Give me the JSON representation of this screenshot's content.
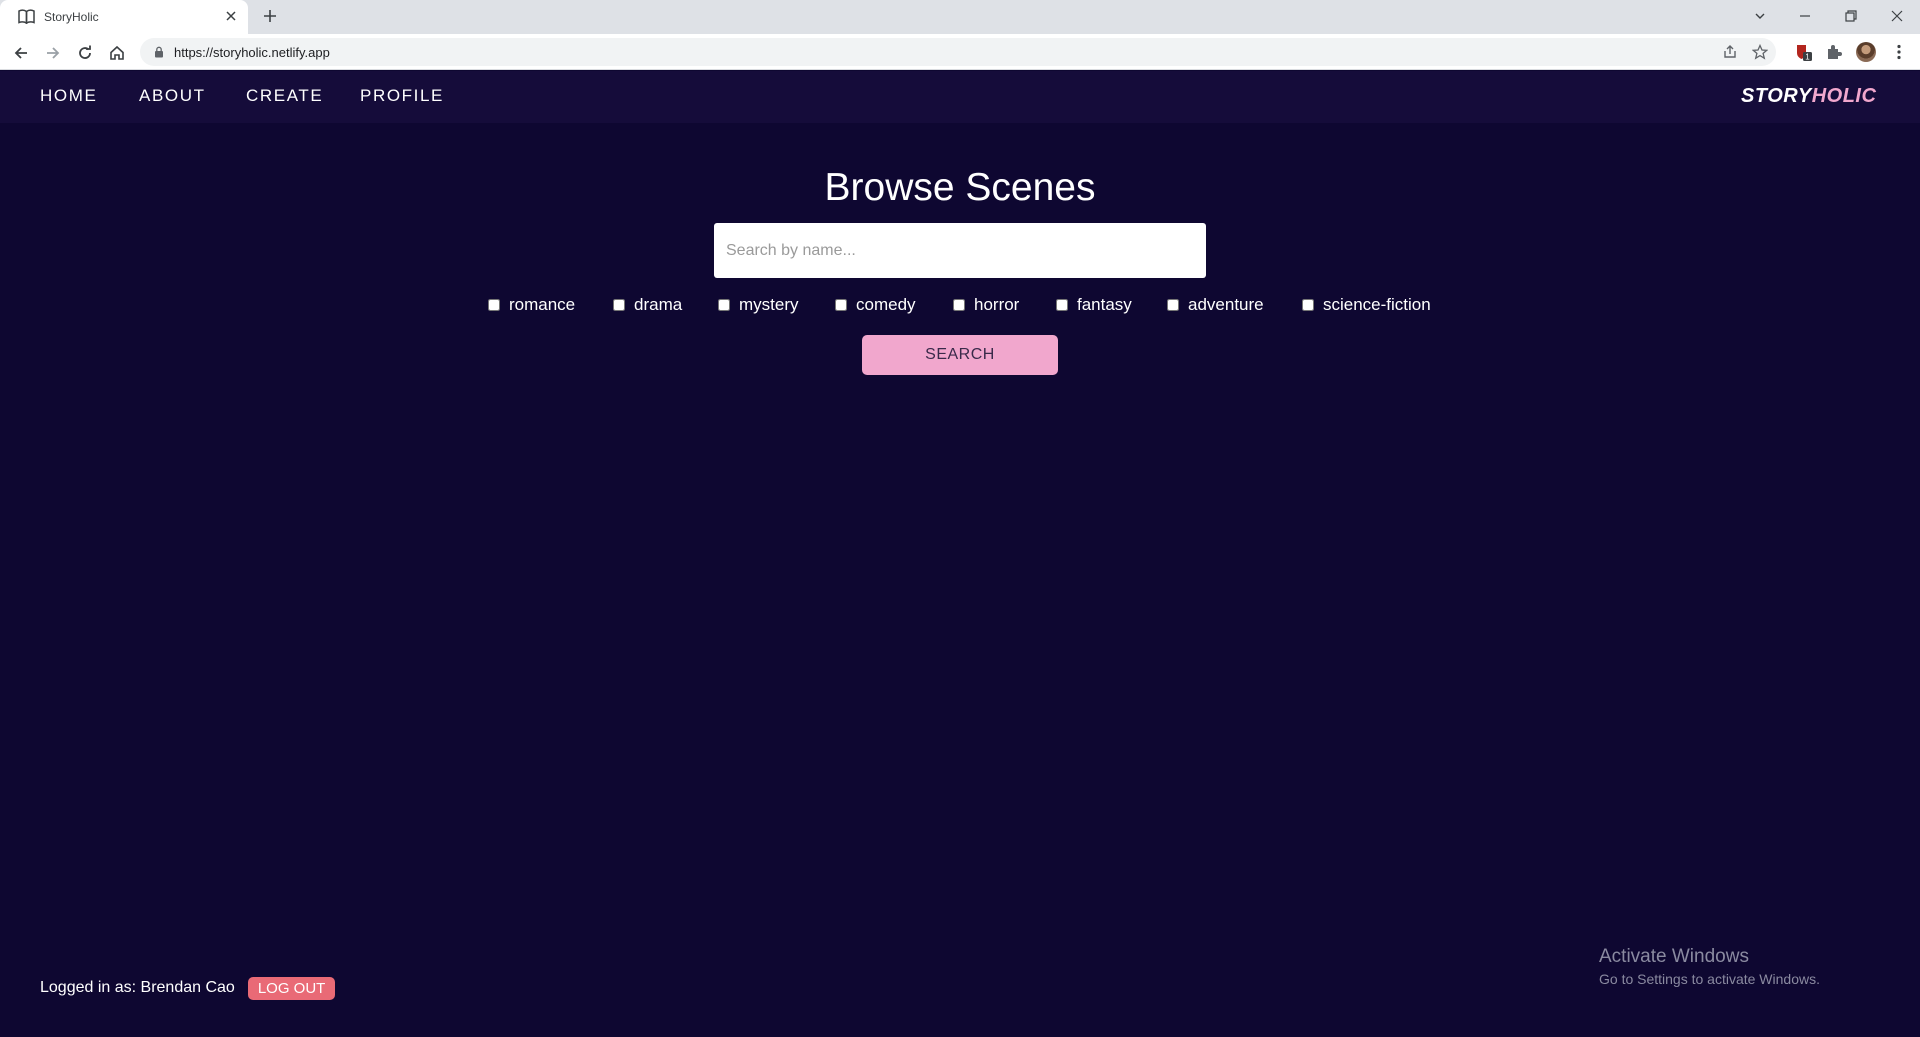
{
  "browser": {
    "tab_title": "StoryHolic",
    "url": "https://storyholic.netlify.app",
    "extension_badge": "1"
  },
  "nav": {
    "links": [
      "HOME",
      "ABOUT",
      "CREATE",
      "PROFILE"
    ],
    "brand_part1": "STORY",
    "brand_part2": "HOLIC"
  },
  "main": {
    "title": "Browse Scenes",
    "search_placeholder": "Search by name...",
    "genres": [
      "romance",
      "drama",
      "mystery",
      "comedy",
      "horror",
      "fantasy",
      "adventure",
      "science-fiction"
    ],
    "search_button": "SEARCH"
  },
  "footer": {
    "logged_in_text": "Logged in as: Brendan Cao",
    "logout_button": "LOG OUT"
  },
  "watermark": {
    "line1": "Activate Windows",
    "line2": "Go to Settings to activate Windows."
  },
  "colors": {
    "page_bg": "#0e0731",
    "nav_bg": "#150c3a",
    "accent_pink": "#f1a7cd",
    "logout_red": "#e96a76"
  }
}
